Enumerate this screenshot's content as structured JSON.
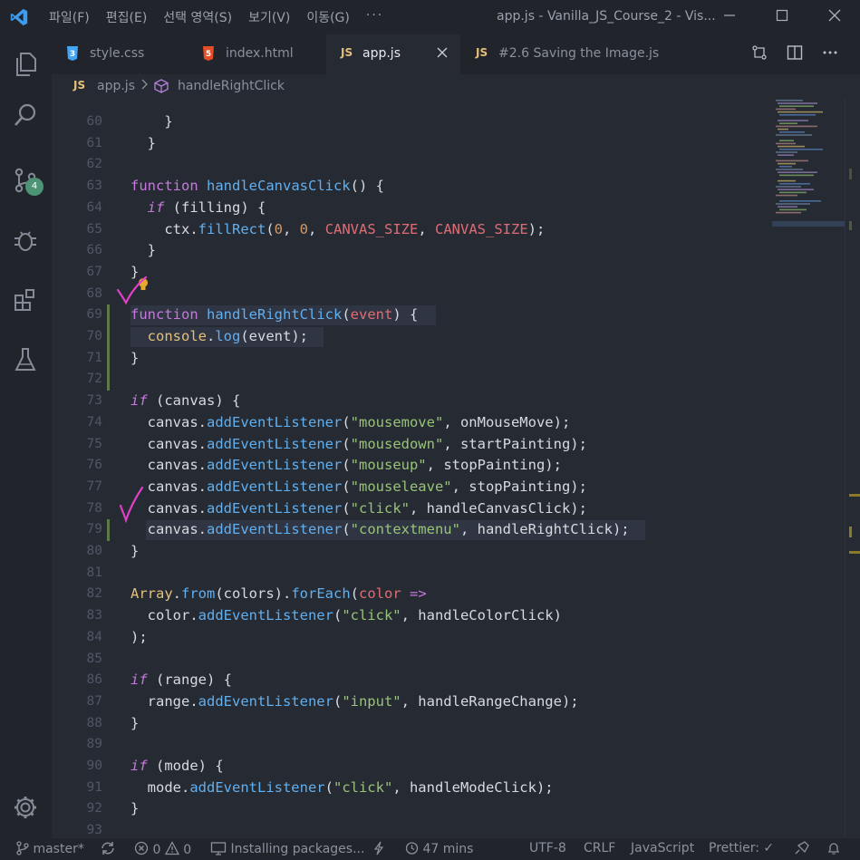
{
  "menu": [
    "파일(F)",
    "편집(E)",
    "선택 영역(S)",
    "보기(V)",
    "이동(G)",
    "···"
  ],
  "window_title": "app.js - Vanilla_JS_Course_2 - Vis...",
  "activity": {
    "scm_badge": "4"
  },
  "tabs": [
    {
      "icon": "css-icon",
      "label": "style.css",
      "active": false
    },
    {
      "icon": "html-icon",
      "label": "index.html",
      "active": false
    },
    {
      "icon": "js-icon",
      "icon_text": "JS",
      "label": "app.js",
      "active": true
    },
    {
      "icon": "js-icon",
      "icon_text": "JS",
      "label": "#2.6 Saving the Image.js",
      "active": false
    }
  ],
  "breadcrumb": {
    "js_badge": "JS",
    "file": "app.js",
    "symbol": "handleRightClick"
  },
  "code_lines": [
    {
      "n": "60",
      "tokens": [
        [
          "pun",
          "    }"
        ]
      ]
    },
    {
      "n": "61",
      "tokens": [
        [
          "pun",
          "  }"
        ]
      ]
    },
    {
      "n": "62",
      "tokens": []
    },
    {
      "n": "63",
      "tokens": [
        [
          "kw",
          "function "
        ],
        [
          "fn",
          "handleCanvasClick"
        ],
        [
          "pun",
          "() {"
        ]
      ]
    },
    {
      "n": "64",
      "tokens": [
        [
          "kwi",
          "  if "
        ],
        [
          "pun",
          "(filling) {"
        ]
      ]
    },
    {
      "n": "65",
      "tokens": [
        [
          "pun",
          "    ctx."
        ],
        [
          "fn",
          "fillRect"
        ],
        [
          "pun",
          "("
        ],
        [
          "num",
          "0"
        ],
        [
          "pun",
          ", "
        ],
        [
          "num",
          "0"
        ],
        [
          "pun",
          ", "
        ],
        [
          "const",
          "CANVAS_SIZE"
        ],
        [
          "pun",
          ", "
        ],
        [
          "const",
          "CANVAS_SIZE"
        ],
        [
          "pun",
          ");"
        ]
      ]
    },
    {
      "n": "66",
      "tokens": [
        [
          "pun",
          "  }"
        ]
      ]
    },
    {
      "n": "67",
      "tokens": [
        [
          "pun",
          "}"
        ]
      ]
    },
    {
      "n": "68",
      "tokens": []
    },
    {
      "n": "69",
      "tokens": [
        [
          "kw",
          "function "
        ],
        [
          "fn",
          "handleRightClick"
        ],
        [
          "pun",
          "("
        ],
        [
          "param",
          "event"
        ],
        [
          "pun",
          ") {"
        ]
      ]
    },
    {
      "n": "70",
      "tokens": [
        [
          "cls",
          "  console"
        ],
        [
          "pun",
          "."
        ],
        [
          "fn",
          "log"
        ],
        [
          "pun",
          "(event);"
        ]
      ]
    },
    {
      "n": "71",
      "tokens": [
        [
          "pun",
          "}"
        ]
      ]
    },
    {
      "n": "72",
      "tokens": []
    },
    {
      "n": "73",
      "tokens": [
        [
          "kwi",
          "if "
        ],
        [
          "pun",
          "(canvas) {"
        ]
      ]
    },
    {
      "n": "74",
      "tokens": [
        [
          "pun",
          "  canvas."
        ],
        [
          "fn",
          "addEventListener"
        ],
        [
          "pun",
          "("
        ],
        [
          "str",
          "\"mousemove\""
        ],
        [
          "pun",
          ", onMouseMove);"
        ]
      ]
    },
    {
      "n": "75",
      "tokens": [
        [
          "pun",
          "  canvas."
        ],
        [
          "fn",
          "addEventListener"
        ],
        [
          "pun",
          "("
        ],
        [
          "str",
          "\"mousedown\""
        ],
        [
          "pun",
          ", startPainting);"
        ]
      ]
    },
    {
      "n": "76",
      "tokens": [
        [
          "pun",
          "  canvas."
        ],
        [
          "fn",
          "addEventListener"
        ],
        [
          "pun",
          "("
        ],
        [
          "str",
          "\"mouseup\""
        ],
        [
          "pun",
          ", stopPainting);"
        ]
      ]
    },
    {
      "n": "77",
      "tokens": [
        [
          "pun",
          "  canvas."
        ],
        [
          "fn",
          "addEventListener"
        ],
        [
          "pun",
          "("
        ],
        [
          "str",
          "\"mouseleave\""
        ],
        [
          "pun",
          ", stopPainting);"
        ]
      ]
    },
    {
      "n": "78",
      "tokens": [
        [
          "pun",
          "  canvas."
        ],
        [
          "fn",
          "addEventListener"
        ],
        [
          "pun",
          "("
        ],
        [
          "str",
          "\"click\""
        ],
        [
          "pun",
          ", handleCanvasClick);"
        ]
      ]
    },
    {
      "n": "79",
      "tokens": [
        [
          "pun",
          "  canvas."
        ],
        [
          "fn",
          "addEventListener"
        ],
        [
          "pun",
          "("
        ],
        [
          "str",
          "\"contextmenu\""
        ],
        [
          "pun",
          ", handleRightClick);"
        ]
      ]
    },
    {
      "n": "80",
      "tokens": [
        [
          "pun",
          "}"
        ]
      ]
    },
    {
      "n": "81",
      "tokens": []
    },
    {
      "n": "82",
      "tokens": [
        [
          "cls",
          "Array"
        ],
        [
          "pun",
          "."
        ],
        [
          "fn",
          "from"
        ],
        [
          "pun",
          "(colors)."
        ],
        [
          "fn",
          "forEach"
        ],
        [
          "pun",
          "("
        ],
        [
          "param",
          "color"
        ],
        [
          "kw",
          " =>"
        ]
      ]
    },
    {
      "n": "83",
      "tokens": [
        [
          "pun",
          "  color."
        ],
        [
          "fn",
          "addEventListener"
        ],
        [
          "pun",
          "("
        ],
        [
          "str",
          "\"click\""
        ],
        [
          "pun",
          ", handleColorClick)"
        ]
      ]
    },
    {
      "n": "84",
      "tokens": [
        [
          "pun",
          ");"
        ]
      ]
    },
    {
      "n": "85",
      "tokens": []
    },
    {
      "n": "86",
      "tokens": [
        [
          "kwi",
          "if "
        ],
        [
          "pun",
          "(range) {"
        ]
      ]
    },
    {
      "n": "87",
      "tokens": [
        [
          "pun",
          "  range."
        ],
        [
          "fn",
          "addEventListener"
        ],
        [
          "pun",
          "("
        ],
        [
          "str",
          "\"input\""
        ],
        [
          "pun",
          ", handleRangeChange);"
        ]
      ]
    },
    {
      "n": "88",
      "tokens": [
        [
          "pun",
          "}"
        ]
      ]
    },
    {
      "n": "89",
      "tokens": []
    },
    {
      "n": "90",
      "tokens": [
        [
          "kwi",
          "if "
        ],
        [
          "pun",
          "(mode) {"
        ]
      ]
    },
    {
      "n": "91",
      "tokens": [
        [
          "pun",
          "  mode."
        ],
        [
          "fn",
          "addEventListener"
        ],
        [
          "pun",
          "("
        ],
        [
          "str",
          "\"click\""
        ],
        [
          "pun",
          ", handleModeClick);"
        ]
      ]
    },
    {
      "n": "92",
      "tokens": [
        [
          "pun",
          "}"
        ]
      ]
    },
    {
      "n": "93",
      "tokens": []
    }
  ],
  "statusbar": {
    "branch": "master*",
    "errors": "0",
    "warnings": "0",
    "installing": "Installing packages...",
    "time": "47 mins",
    "encoding": "UTF-8",
    "eol": "CRLF",
    "language": "JavaScript",
    "prettier": "Prettier: ✓"
  },
  "colors": {
    "accent_green": "#4d9375",
    "annotation_pink": "#e040c8",
    "bulb": "#e5a92b"
  }
}
